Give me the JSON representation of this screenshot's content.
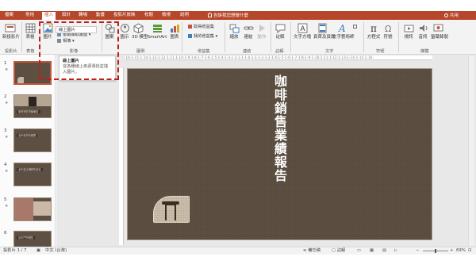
{
  "tabs": [
    "檔案",
    "常用",
    "插入",
    "設計",
    "轉場",
    "動畫",
    "投影片放映",
    "校閱",
    "檢視",
    "說明"
  ],
  "active_tab": "插入",
  "tell_me": "告訴我您想做什麼",
  "share": "共用",
  "ribbon": {
    "new_slide": "新投影片",
    "table": "表格",
    "picture": "圖片",
    "screenshot": "螢幕擷取畫面",
    "album": "相簿",
    "shapes": "圖案",
    "icons": "圖示",
    "models3d": "3D 模型",
    "smartart": "SmartArt",
    "chart": "圖表",
    "get_addins": "取得增益集",
    "my_addins": "我的增益集",
    "zoom": "縮放",
    "link": "連結",
    "action": "動作",
    "comment": "註解",
    "textbox": "文字方塊",
    "header_footer": "頁首及頁尾",
    "wordart": "文字藝術師",
    "equation": "方程式",
    "symbol": "符號",
    "video": "視訊",
    "audio": "音訊",
    "screen_recording": "螢幕錄製",
    "groups": {
      "slides": "投影片",
      "tables": "表格",
      "images": "影像",
      "illustrations": "圖例",
      "addins": "增益集",
      "links": "連結",
      "comments": "註解",
      "text": "文字",
      "symbols": "符號",
      "media": "媒體"
    }
  },
  "picture_dropdown_item": "線上圖片",
  "tooltip": {
    "title": "線上圖片",
    "desc": "從各種線上來源尋找並插入圖片。"
  },
  "ruler_text": "·16·1·15·1·14·1·13·1·12·1·11·1·10·1·9·1·8·1·7·1·6·1·5·1·4·1·3·1·2·1·1·1·0·1·1·1·2·1·3·1·4·1·5·1·6·1·7·1·8·1·9·1·10·1·11·1·12·1·13·1·14·1·15·1·16·",
  "slide_title": "咖啡銷售業績報告",
  "thumbnails": [
    {
      "num": "1",
      "caption": ""
    },
    {
      "num": "2",
      "caption": "咖啡銷售業績報告"
    },
    {
      "num": "3",
      "caption": "全年度營收總攬"
    },
    {
      "num": "4",
      "caption": "全年度店鋪銷售細目"
    },
    {
      "num": "5",
      "caption": ""
    },
    {
      "num": "6",
      "caption": "台中門市銷售"
    }
  ],
  "status": {
    "slide": "投影片 1 / 7",
    "language": "中文 (台灣)",
    "notes": "備忘稿",
    "comments": "註解",
    "zoom": "69%"
  },
  "colors": {
    "accent": "#b7472a",
    "slide_bg": "#5d4e42",
    "highlight": "#c41b1b"
  }
}
